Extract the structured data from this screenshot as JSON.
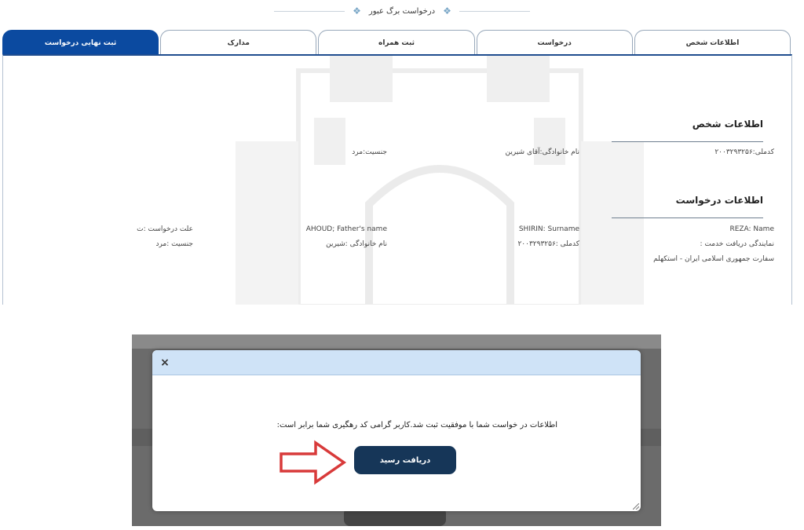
{
  "header": {
    "title": "درخواست برگ عبور"
  },
  "tabs": [
    {
      "label": "ثبت نهایی درخواست",
      "active": true
    },
    {
      "label": "مدارک",
      "active": false
    },
    {
      "label": "ثبت همراه",
      "active": false
    },
    {
      "label": "درخواست",
      "active": false
    },
    {
      "label": "اطلاعات شخص",
      "active": false
    }
  ],
  "person_section": {
    "title": "اطلاعات شخص",
    "national_id": "کدملی:۲۰۰۳۲۹۳۲۵۶",
    "family_name": "نام خانوادگی:آقای شیرین",
    "gender": "جنسیت:مرد"
  },
  "request_section": {
    "title": "اطلاعات درخواست",
    "name": "REZA: Name",
    "surname": "SHIRIN: Surname",
    "fathers_name": "AHOUD; Father's name",
    "reason": "علت درخواست :ت",
    "service_rep_label": "نمایندگی دریافت خدمت :",
    "service_rep_value": "سفارت جمهوری اسلامی ایران - استکهلم",
    "national_id": "کدملی :۲۰۰۳۲۹۳۲۵۶",
    "family_name": "نام خانوادگی :شیرین",
    "gender": "جنسیت :مرد"
  },
  "modal": {
    "close_label": "×",
    "message": "اطلاعات در خواست شما با موفقیت ثبت شد.کاربر گرامی کد رهگیری شما برابر است:",
    "receipt_button": "دریافت رسید"
  },
  "colors": {
    "active_tab": "#0b4aa0",
    "modal_header": "#cfe3f7",
    "receipt_button": "#163658",
    "arrow_stroke": "#d83a3a"
  },
  "icons": {
    "close": "close-icon",
    "arrow": "arrow-right-icon",
    "ornament": "ornament-icon"
  }
}
